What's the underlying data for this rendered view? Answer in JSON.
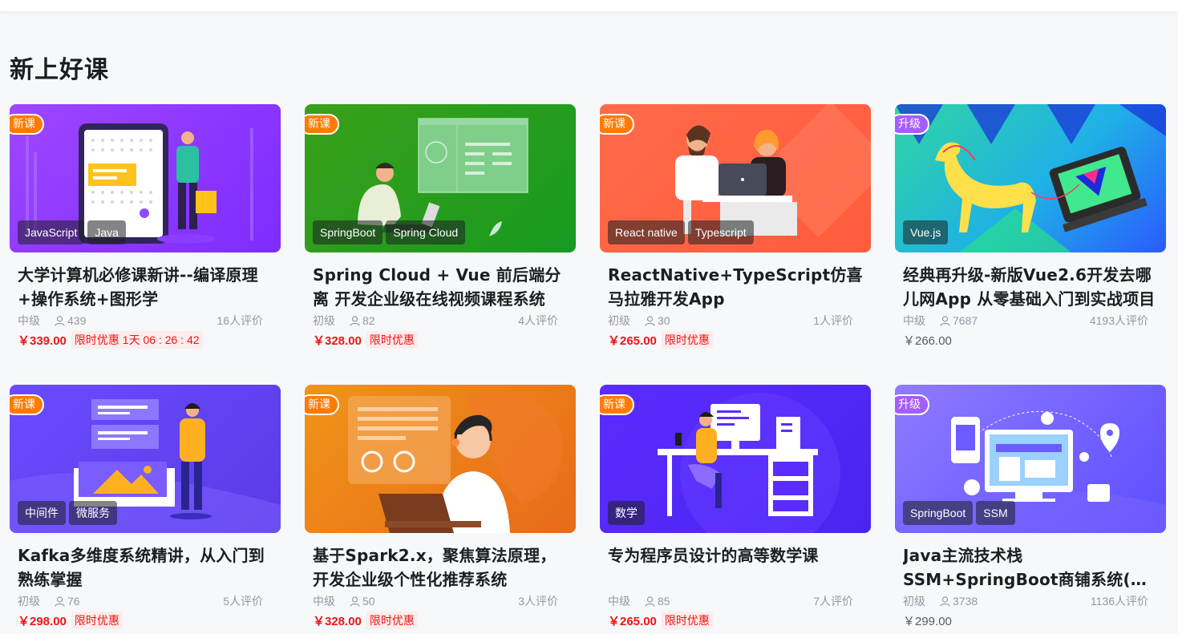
{
  "section": {
    "title": "新上好课"
  },
  "colors": {
    "accent_red": "#f01414",
    "new_badge": "#ff7a00",
    "upgrade_badge": "#a65dff"
  },
  "courses": [
    {
      "badge": "新课",
      "badge_type": "new",
      "tags": [
        "JavaScript",
        "Java"
      ],
      "title": "大学计算机必修课新讲--编译原理+操作系统+图形学",
      "level": "中级",
      "students": "439",
      "reviews": "16人评价",
      "price": "￥339.00",
      "promo": "限时优惠 1天 06 : 26 : 42",
      "price_style": "sale"
    },
    {
      "badge": "新课",
      "badge_type": "new",
      "tags": [
        "SpringBoot",
        "Spring Cloud"
      ],
      "title": "Spring Cloud + Vue 前后端分离 开发企业级在线视频课程系统",
      "level": "初级",
      "students": "82",
      "reviews": "4人评价",
      "price": "￥328.00",
      "promo": "限时优惠",
      "price_style": "sale"
    },
    {
      "badge": "新课",
      "badge_type": "new",
      "tags": [
        "React native",
        "Typescript"
      ],
      "title": "ReactNative+TypeScript仿喜马拉雅开发App",
      "level": "初级",
      "students": "30",
      "reviews": "1人评价",
      "price": "￥265.00",
      "promo": "限时优惠",
      "price_style": "sale"
    },
    {
      "badge": "升级",
      "badge_type": "up",
      "tags": [
        "Vue.js"
      ],
      "title": "经典再升级-新版Vue2.6开发去哪儿网App 从零基础入门到实战项目",
      "level": "中级",
      "students": "7687",
      "reviews": "4193人评价",
      "price": "￥266.00",
      "promo": "",
      "price_style": "plain"
    },
    {
      "badge": "新课",
      "badge_type": "new",
      "tags": [
        "中间件",
        "微服务"
      ],
      "title": "Kafka多维度系统精讲，从入门到熟练掌握",
      "level": "初级",
      "students": "76",
      "reviews": "5人评价",
      "price": "￥298.00",
      "promo": "限时优惠",
      "price_style": "sale"
    },
    {
      "badge": "新课",
      "badge_type": "new",
      "tags": [],
      "title": "基于Spark2.x，聚焦算法原理，开发企业级个性化推荐系统",
      "level": "中级",
      "students": "50",
      "reviews": "3人评价",
      "price": "￥328.00",
      "promo": "限时优惠",
      "price_style": "sale"
    },
    {
      "badge": "新课",
      "badge_type": "new",
      "tags": [
        "数学"
      ],
      "title": "专为程序员设计的高等数学课",
      "level": "中级",
      "students": "85",
      "reviews": "7人评价",
      "price": "￥265.00",
      "promo": "限时优惠",
      "price_style": "sale"
    },
    {
      "badge": "升级",
      "badge_type": "up",
      "tags": [
        "SpringBoot",
        "SSM"
      ],
      "title": "Java主流技术栈SSM+SpringBoot商铺系统(升级版)",
      "level": "初级",
      "students": "3738",
      "reviews": "1136人评价",
      "price": "￥299.00",
      "promo": "",
      "price_style": "plain"
    }
  ]
}
